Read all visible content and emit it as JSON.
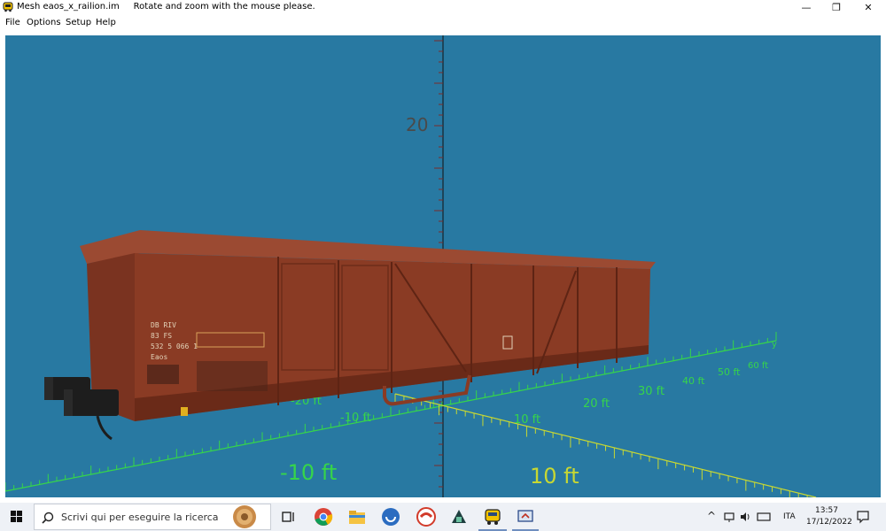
{
  "window": {
    "title": "Mesh eaos_x_railion.im",
    "hint": "Rotate and zoom with the mouse please.",
    "controls": {
      "minimize": "—",
      "maximize": "❐",
      "close": "✕"
    }
  },
  "menu": [
    "File",
    "Options",
    "Setup",
    "Help"
  ],
  "viewport": {
    "background": "#2879a2",
    "vertical_axis_label": "20",
    "grid_labels_green": [
      "-20 ft",
      "-10 ft",
      "10 ft",
      "20 ft",
      "30 ft",
      "40 ft",
      "50 ft",
      "60 ft"
    ],
    "grid_axis_end": "y",
    "large_labels": [
      "-10 ft",
      "10 ft"
    ],
    "wagon_markings": [
      "DB RIV",
      "83 FS",
      "532 5 066 1",
      "Eaos"
    ]
  },
  "taskbar": {
    "search_placeholder": "Scrivi qui per eseguire la ricerca",
    "language": "ITA",
    "time": "13:57",
    "date": "17/12/2022",
    "icons": [
      "task-view-icon",
      "chrome-icon",
      "file-explorer-icon",
      "app-blue-icon",
      "app-red-icon",
      "app-dark-icon",
      "train-app-icon",
      "settings-app-icon"
    ]
  },
  "colors": {
    "green_grid": "#36d54a",
    "yellow_grid": "#c8d832",
    "wagon": "#8a3b24"
  }
}
